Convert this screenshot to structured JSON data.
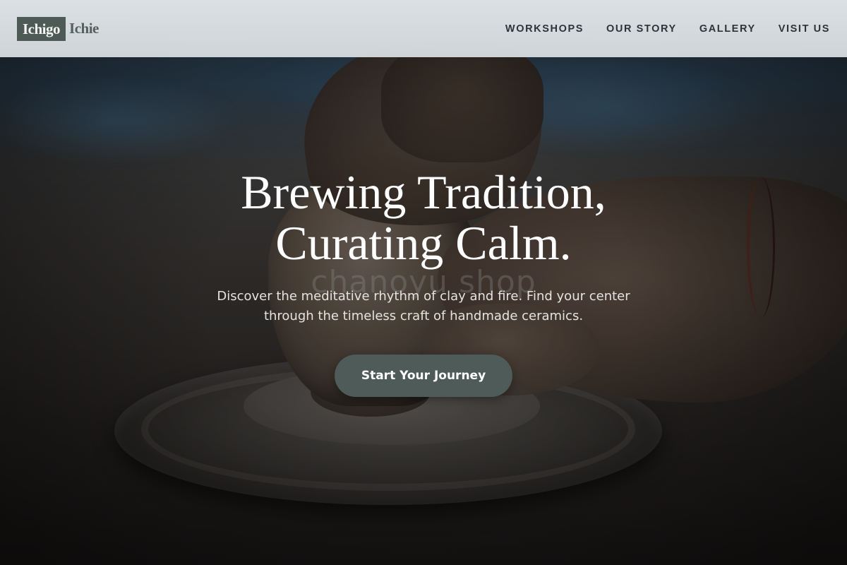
{
  "brand": {
    "logo_box_text": "Ichigo",
    "logo_text": "Ichie",
    "logo_color": "#4e5a56"
  },
  "nav": {
    "items": [
      {
        "label": "WORKSHOPS"
      },
      {
        "label": "OUR STORY"
      },
      {
        "label": "GALLERY"
      },
      {
        "label": "VISIT US"
      }
    ]
  },
  "hero": {
    "title_line1": "Brewing Tradition,",
    "title_line2": "Curating Calm.",
    "subtitle": "Discover the meditative rhythm of clay and fire. Find your center through the timeless craft of handmade ceramics.",
    "cta_label": "Start Your Journey",
    "cta_color": "#4f5b58",
    "watermark": "chanoyu shop",
    "background_image": "hands-shaping-clay-pot-on-pottery-wheel"
  }
}
